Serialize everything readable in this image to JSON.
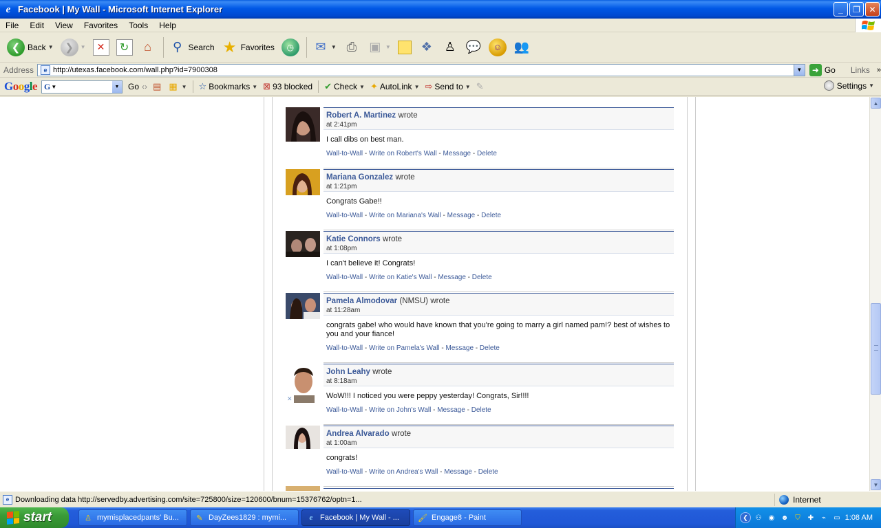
{
  "window": {
    "title": "Facebook | My Wall - Microsoft Internet Explorer"
  },
  "menu": [
    "File",
    "Edit",
    "View",
    "Favorites",
    "Tools",
    "Help"
  ],
  "toolbar": {
    "back_label": "Back",
    "search_label": "Search",
    "favorites_label": "Favorites"
  },
  "address": {
    "label": "Address",
    "url": "http://utexas.facebook.com/wall.php?id=7900308",
    "go_label": "Go",
    "links_label": "Links"
  },
  "google_toolbar": {
    "logo": "Google",
    "go_label": "Go",
    "bookmarks_label": "Bookmarks",
    "blocked_label": "93 blocked",
    "check_label": "Check",
    "autolink_label": "AutoLink",
    "sendto_label": "Send to",
    "settings_label": "Settings"
  },
  "wall_posts": [
    {
      "author": "Robert A. Martinez",
      "wrote": "wrote",
      "time": "at 2:41pm",
      "message": "I call dibs on best man.",
      "actions": [
        "Wall-to-Wall",
        "Write on Robert's Wall",
        "Message",
        "Delete"
      ]
    },
    {
      "author": "Mariana Gonzalez",
      "wrote": "wrote",
      "time": "at 1:21pm",
      "message": "Congrats Gabe!!",
      "actions": [
        "Wall-to-Wall",
        "Write on Mariana's Wall",
        "Message",
        "Delete"
      ]
    },
    {
      "author": "Katie Connors",
      "wrote": "wrote",
      "time": "at 1:08pm",
      "message": "I can't believe it! Congrats!",
      "actions": [
        "Wall-to-Wall",
        "Write on Katie's Wall",
        "Message",
        "Delete"
      ]
    },
    {
      "author": "Pamela Almodovar",
      "school": "(NMSU)",
      "wrote": "wrote",
      "time": "at 11:28am",
      "message": "congrats gabe! who would have known that you're going to marry a girl named pam!? best of wishes to you and your fiance!",
      "actions": [
        "Wall-to-Wall",
        "Write on Pamela's Wall",
        "Message",
        "Delete"
      ]
    },
    {
      "author": "John Leahy",
      "wrote": "wrote",
      "time": "at 8:18am",
      "message": "WoW!!! I noticed you were peppy yesterday! Congrats, Sir!!!!",
      "actions": [
        "Wall-to-Wall",
        "Write on John's Wall",
        "Message",
        "Delete"
      ]
    },
    {
      "author": "Andrea Alvarado",
      "wrote": "wrote",
      "time": "at 1:00am",
      "message": "congrats!",
      "actions": [
        "Wall-to-Wall",
        "Write on Andrea's Wall",
        "Message",
        "Delete"
      ]
    }
  ],
  "action_separator": " - ",
  "status": {
    "text": "Downloading data http://servedby.advertising.com/site=725800/size=120600/bnum=15376762/optn=1...",
    "zone": "Internet"
  },
  "taskbar": {
    "start_label": "start",
    "tasks": [
      {
        "label": "mymisplacedpants' Bu...",
        "icon": "aim-icon"
      },
      {
        "label": "DayZees1829 : mymi...",
        "icon": "im-icon"
      },
      {
        "label": "Facebook | My Wall - ...",
        "icon": "ie-icon"
      },
      {
        "label": "Engage8 - Paint",
        "icon": "paint-icon"
      }
    ],
    "clock": "1:08 AM"
  },
  "colors": {
    "facebook_link": "#3b5998",
    "xp_blue": "#0058e6",
    "start_green": "#3a9b37"
  }
}
